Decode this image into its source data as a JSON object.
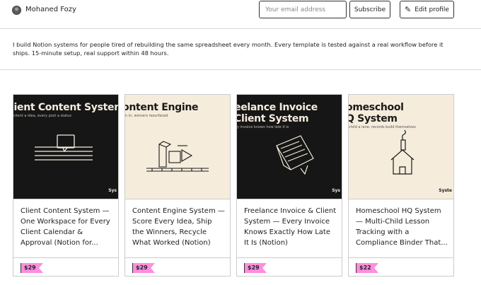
{
  "header": {
    "username": "Mohaned Fozy",
    "email_placeholder": "Your email address",
    "subscribe_label": "Subscribe",
    "edit_profile_label": "Edit profile"
  },
  "bio": "I build Notion systems for people tired of rebuilding the same spreadsheet every month. Every template is tested against a real workflow before it ships. 15-minute setup, real support within 48 hours.",
  "products": [
    {
      "thumb_title": [
        "lient Content System"
      ],
      "thumb_sub": "client a idea, every post a status",
      "thumb_brand": "Sys",
      "title": "Client Content System — One Workspace for Every Client Calendar & Approval (Notion for...",
      "price": "$29"
    },
    {
      "thumb_title": [
        "ontent Engine"
      ],
      "thumb_sub": "n in, winners resurfaced",
      "thumb_brand": "",
      "title": "Content Engine System — Score Every Idea, Ship the Winners, Recycle What Worked (Notion)",
      "price": "$29"
    },
    {
      "thumb_title": [
        "eelance Invoice",
        "Client System"
      ],
      "thumb_sub": "y invoice knows how late it is",
      "thumb_brand": "Sys",
      "title": "Freelance Invoice & Client System — Every Invoice Knows Exactly How Late It Is (Notion)",
      "price": "$29"
    },
    {
      "thumb_title": [
        "omeschool",
        "Q System"
      ],
      "thumb_sub": "child a lane, records build themselves",
      "thumb_brand": "Syste",
      "title": "Homeschool HQ System — Multi-Child Lesson Tracking with a Compliance Binder That...",
      "price": "$22"
    }
  ],
  "colors": {
    "price_tag": "#ff8de0",
    "dark_thumb": "#161616",
    "light_thumb": "#f5ecdc"
  }
}
